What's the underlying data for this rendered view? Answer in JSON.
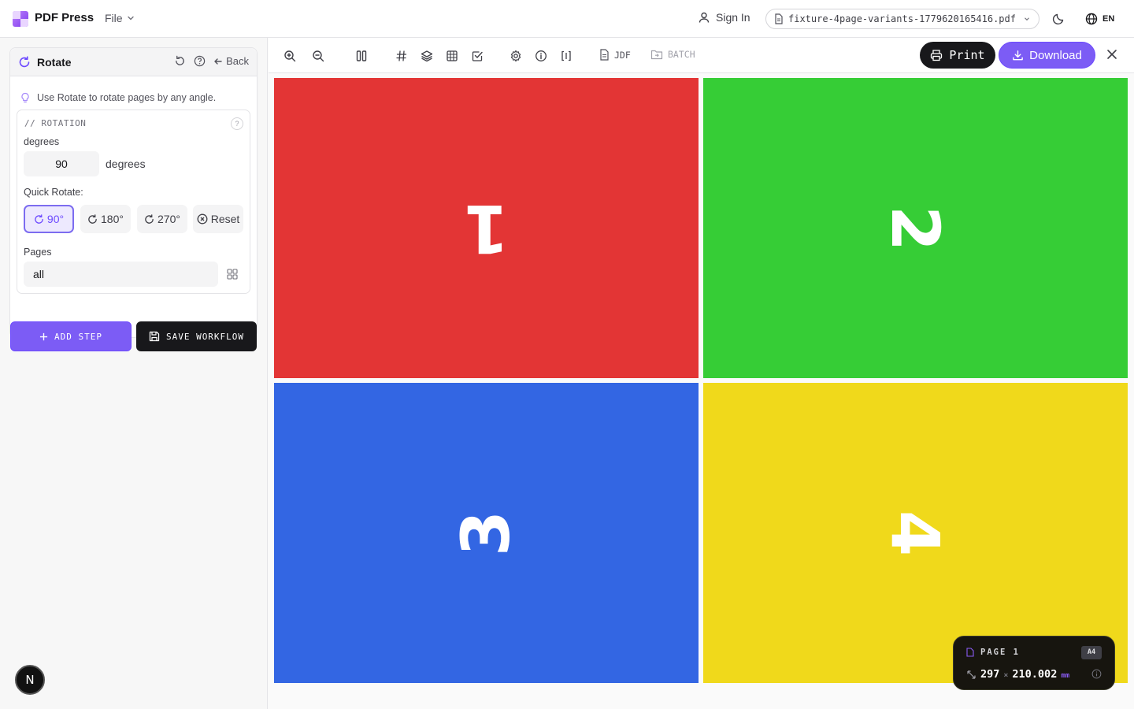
{
  "app": {
    "name": "PDF Press",
    "file_menu": "File"
  },
  "header": {
    "sign_in": "Sign In",
    "file_name": "fixture-4page-variants-1779620165416.pdf",
    "language": "EN"
  },
  "tool": {
    "title": "Rotate",
    "back": "Back",
    "tip": "Use Rotate to rotate pages by any angle.",
    "section_title": "// ROTATION",
    "degrees_label": "degrees",
    "degrees_value": "90",
    "degrees_unit": "degrees",
    "quick_rotate_label": "Quick Rotate:",
    "quick_buttons": [
      {
        "label": "90°",
        "active": true
      },
      {
        "label": "180°",
        "active": false
      },
      {
        "label": "270°",
        "active": false
      },
      {
        "label": "Reset",
        "active": false
      }
    ],
    "pages_label": "Pages",
    "pages_value": "all"
  },
  "actions": {
    "add_step": "ADD STEP",
    "save_workflow": "SAVE WORKFLOW"
  },
  "toolbar": {
    "jdf": "JDF",
    "batch": "BATCH",
    "print": "Print",
    "download": "Download"
  },
  "pages": [
    {
      "number": "1",
      "color": "#e33535",
      "rotation_deg": 180
    },
    {
      "number": "2",
      "color": "#36cd36",
      "rotation_deg": 90
    },
    {
      "number": "3",
      "color": "#3366e3",
      "rotation_deg": -90
    },
    {
      "number": "4",
      "color": "#f0d91b",
      "rotation_deg": 90
    }
  ],
  "page_info": {
    "label": "PAGE 1",
    "size": "A4",
    "width": "297",
    "times": "×",
    "height": "210.002",
    "unit": "mm"
  },
  "dev_badge": "N",
  "colors": {
    "accent": "#7c5cf5",
    "dark": "#18181b"
  }
}
